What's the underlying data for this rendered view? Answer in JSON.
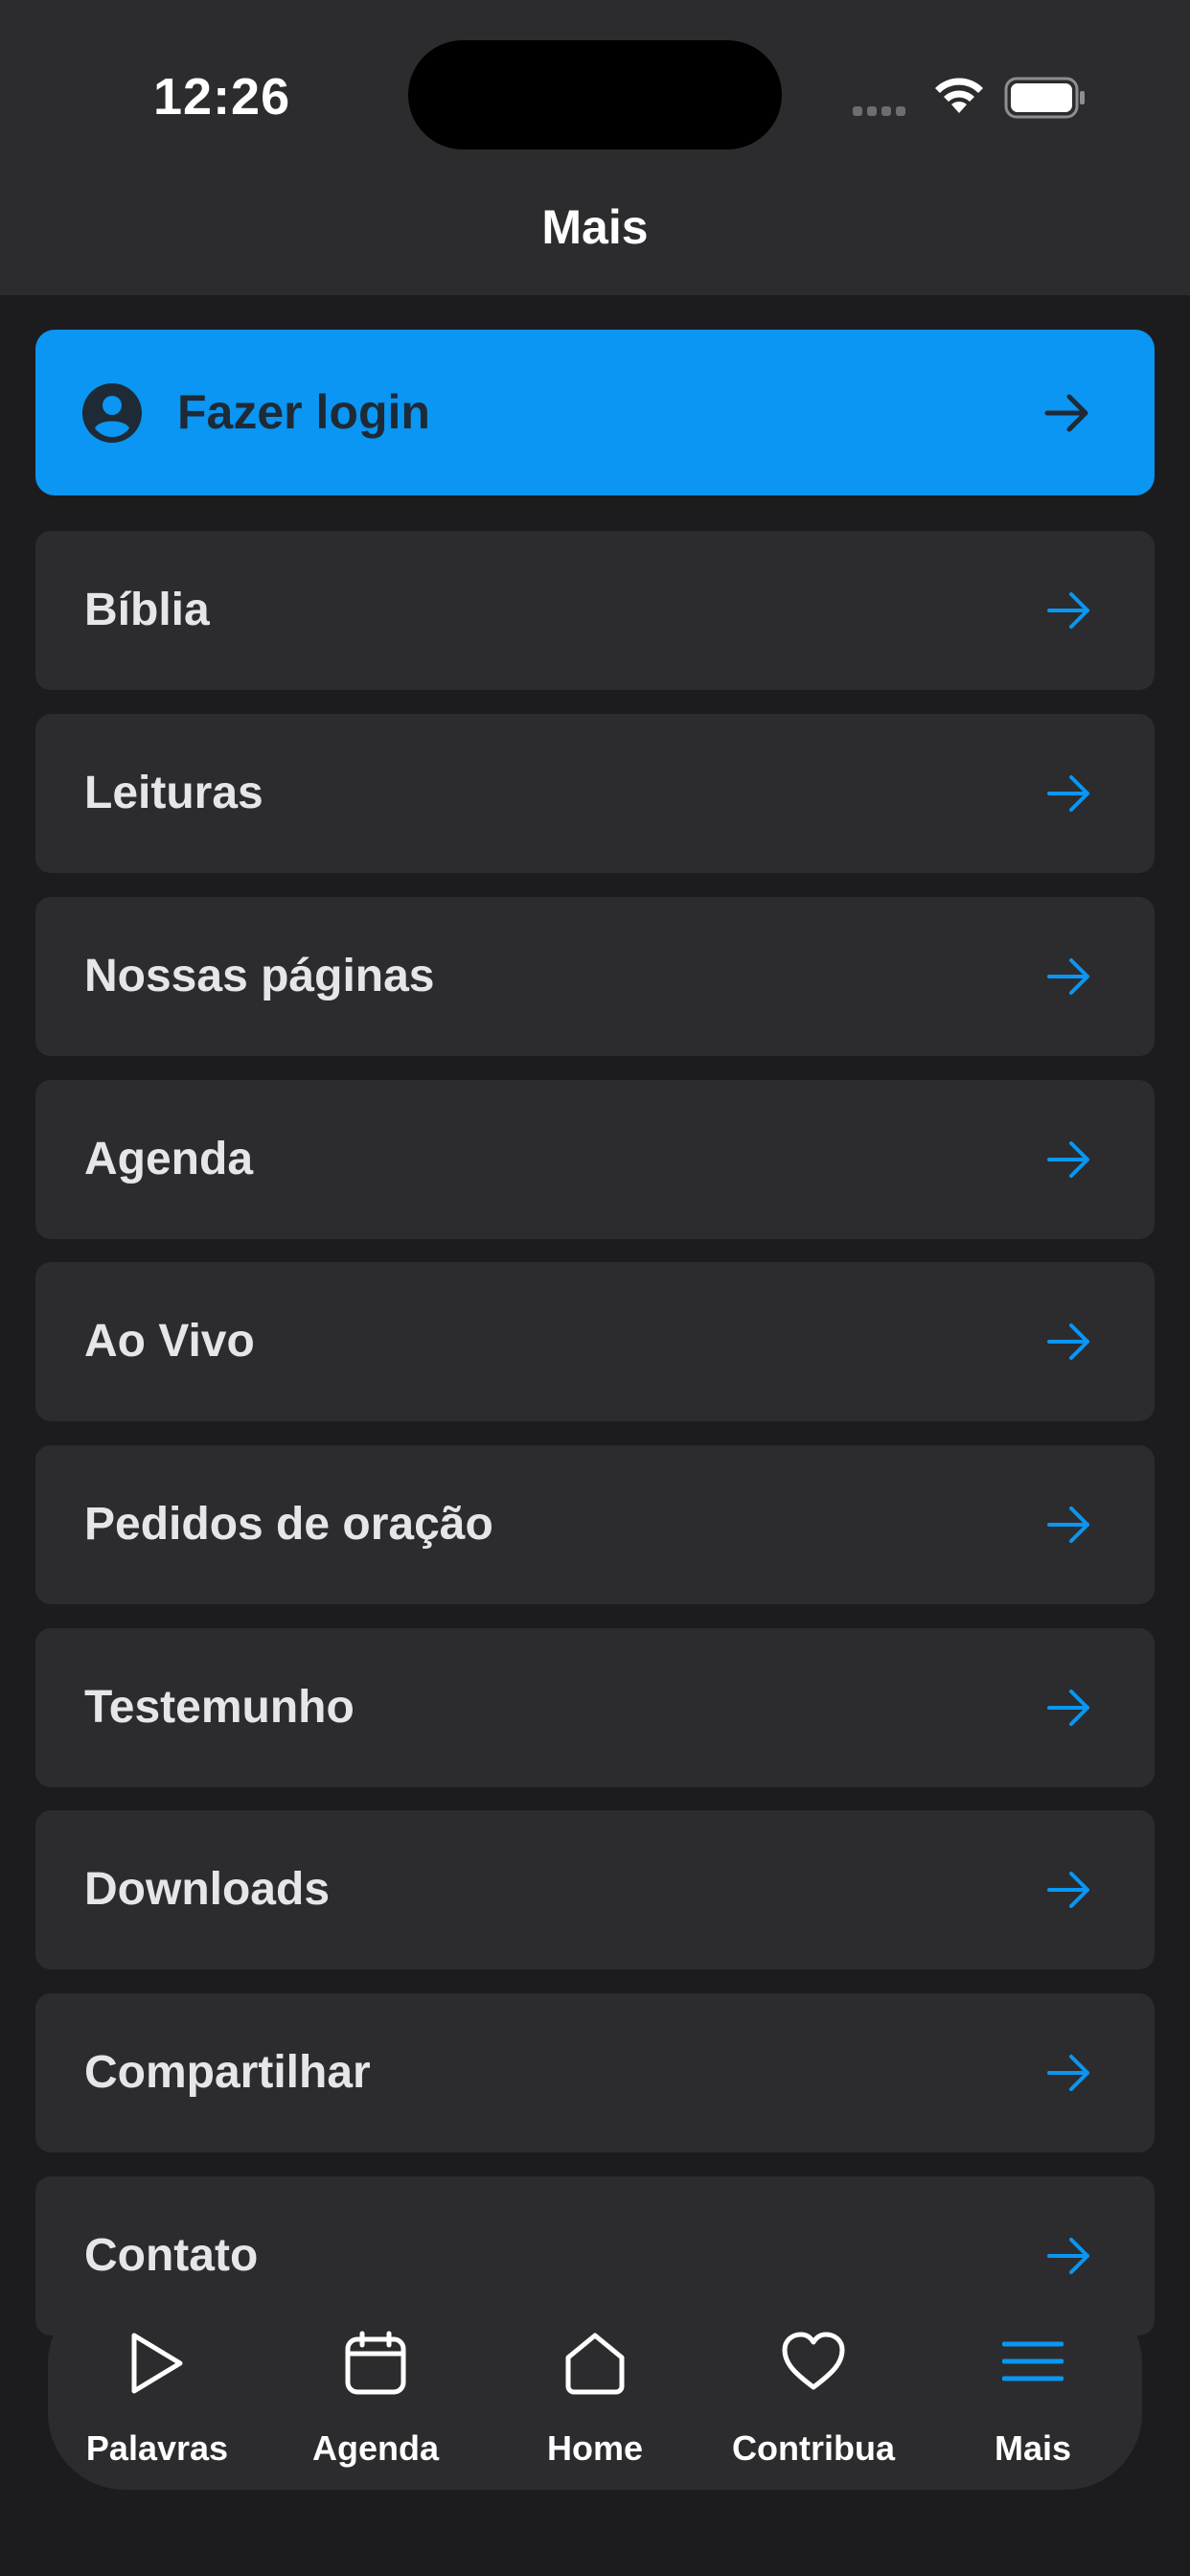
{
  "status_bar": {
    "time": "12:26"
  },
  "header": {
    "title": "Mais"
  },
  "login": {
    "label": "Fazer login",
    "icon": "user-circle-icon"
  },
  "menu": {
    "items": [
      {
        "label": "Bíblia"
      },
      {
        "label": "Leituras"
      },
      {
        "label": "Nossas páginas"
      },
      {
        "label": "Agenda"
      },
      {
        "label": "Ao Vivo"
      },
      {
        "label": "Pedidos de oração"
      },
      {
        "label": "Testemunho"
      },
      {
        "label": "Downloads"
      },
      {
        "label": "Compartilhar"
      },
      {
        "label": "Contato"
      }
    ]
  },
  "tabbar": {
    "tabs": [
      {
        "label": "Palavras",
        "icon": "play-icon"
      },
      {
        "label": "Agenda",
        "icon": "calendar-icon"
      },
      {
        "label": "Home",
        "icon": "home-icon"
      },
      {
        "label": "Contribua",
        "icon": "heart-icon"
      },
      {
        "label": "Mais",
        "icon": "menu-icon",
        "active": true
      }
    ]
  },
  "colors": {
    "accent": "#0a96f2",
    "background": "#1c1c1e",
    "card": "#2c2c2e",
    "login_text": "#1e2a36"
  }
}
